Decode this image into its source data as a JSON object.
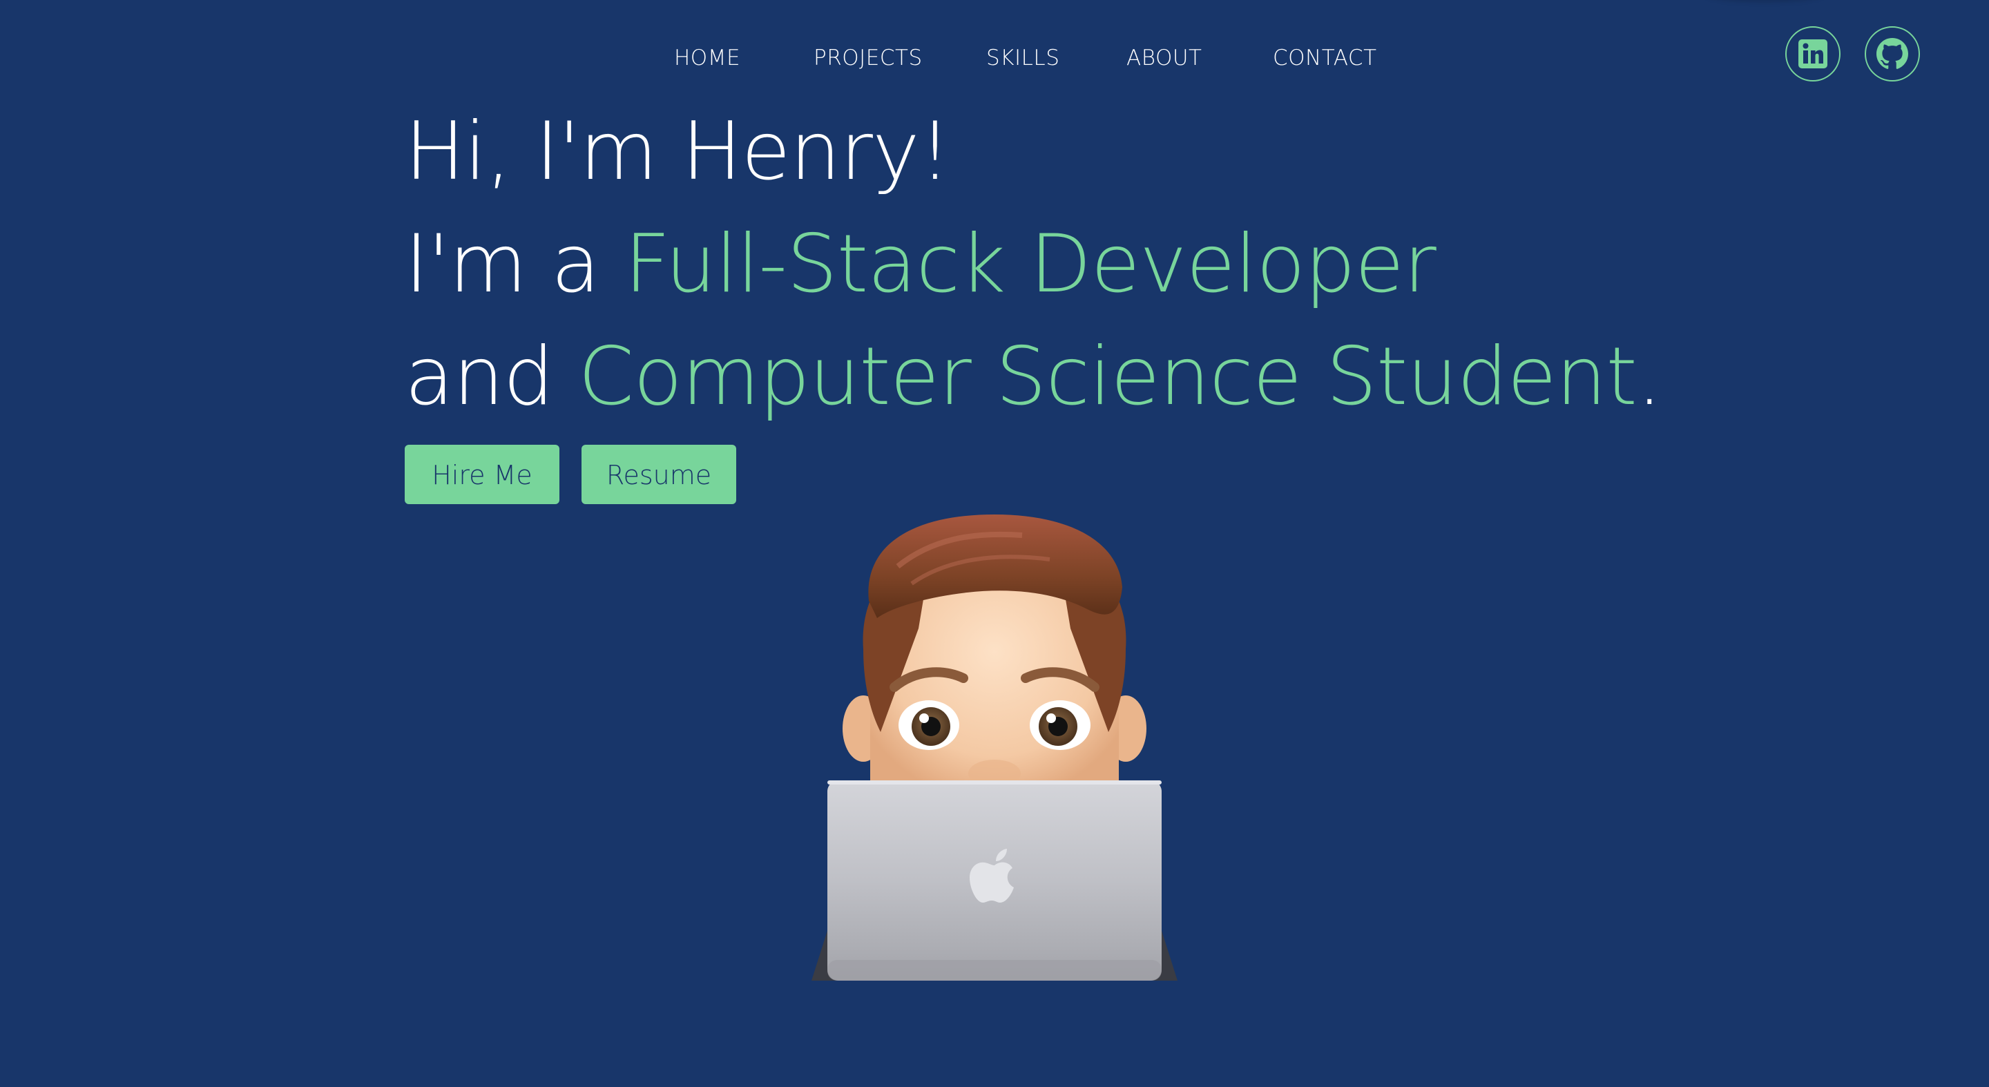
{
  "nav": {
    "items": [
      "HOME",
      "PROJECTS",
      "SKILLS",
      "ABOUT",
      "CONTACT"
    ]
  },
  "social": {
    "linkedin_icon": "linkedin-icon",
    "github_icon": "github-icon"
  },
  "hero": {
    "line1": "Hi, I'm Henry!",
    "line2_prefix": "I'm a ",
    "line2_accent": "Full-Stack Developer",
    "line3_prefix": "and ",
    "line3_accent": "Computer Science Student",
    "line3_suffix": "."
  },
  "buttons": {
    "hire": "Hire Me",
    "resume": "Resume"
  },
  "colors": {
    "background": "#18366a",
    "accent": "#78d59b",
    "text": "#ffffff"
  },
  "illustration": {
    "icon": "memoji-with-laptop"
  }
}
